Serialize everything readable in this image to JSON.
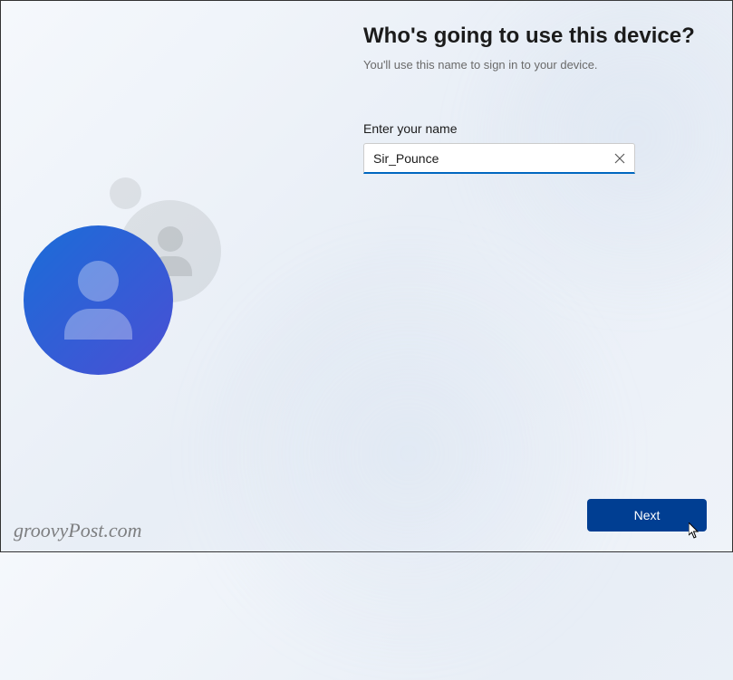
{
  "setup": {
    "title": "Who's going to use this device?",
    "subtitle": "You'll use this name to sign in to your device.",
    "field_label": "Enter your name",
    "name_value": "Sir_Pounce",
    "next_button": "Next"
  },
  "watermark": "groovyPost.com",
  "colors": {
    "accent": "#0067c0",
    "next_button_bg": "#003e92"
  }
}
